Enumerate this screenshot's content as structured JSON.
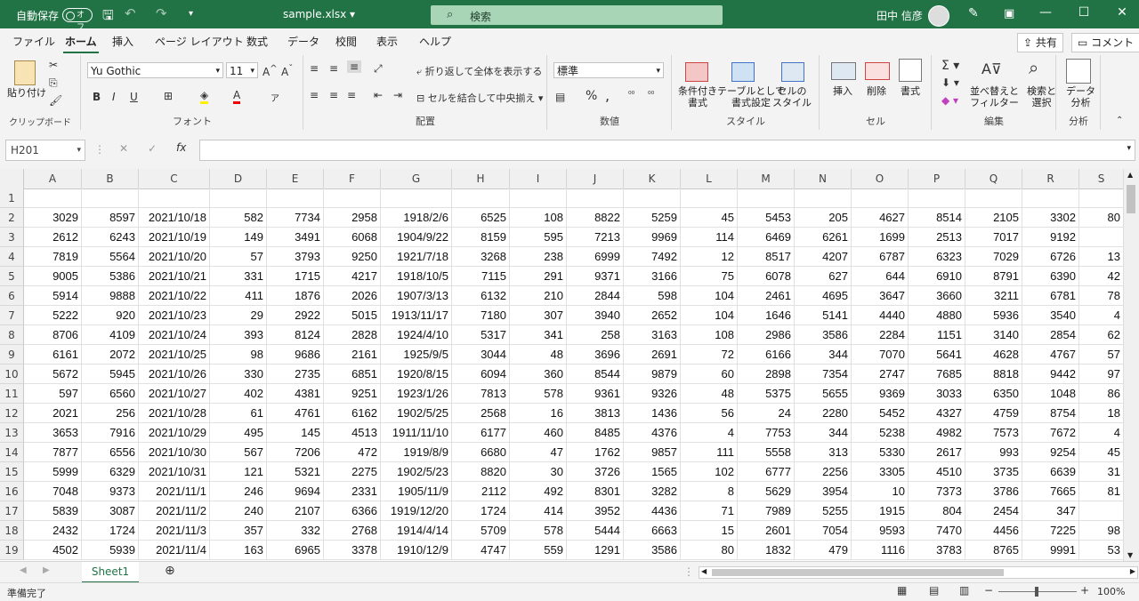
{
  "titlebar": {
    "autosave_label": "自動保存",
    "autosave_state": "オフ",
    "filename": "sample.xlsx ▾",
    "search_placeholder": "検索",
    "user_name": "田中 信彦"
  },
  "tabs": [
    "ファイル",
    "ホーム",
    "挿入",
    "ページ レイアウト",
    "数式",
    "データ",
    "校閲",
    "表示",
    "ヘルプ"
  ],
  "active_tab": "ホーム",
  "actions": {
    "share": "共有",
    "comment": "コメント"
  },
  "ribbon": {
    "clipboard": {
      "paste": "貼り付け",
      "label": "クリップボード"
    },
    "font": {
      "name": "Yu Gothic",
      "size": "11",
      "label": "フォント"
    },
    "alignment": {
      "wrap": "折り返して全体を表示する",
      "merge": "セルを結合して中央揃え",
      "label": "配置"
    },
    "number": {
      "format": "標準",
      "label": "数値"
    },
    "styles": {
      "conditional": "条件付き\n書式",
      "table": "テーブルとして\n書式設定",
      "cell": "セルの\nスタイル",
      "label": "スタイル"
    },
    "cells": {
      "insert": "挿入",
      "delete": "削除",
      "format": "書式",
      "label": "セル"
    },
    "editing": {
      "sort": "並べ替えと\nフィルター",
      "find": "検索と\n選択",
      "label": "編集"
    },
    "analysis": {
      "data": "データ\n分析",
      "label": "分析"
    }
  },
  "formula_bar": {
    "name_box": "H201",
    "value": ""
  },
  "columns": [
    "A",
    "B",
    "C",
    "D",
    "E",
    "F",
    "G",
    "H",
    "I",
    "J",
    "K",
    "L",
    "M",
    "N",
    "O",
    "P",
    "Q",
    "R",
    "S"
  ],
  "row_numbers": [
    "1",
    "2",
    "3",
    "4",
    "5",
    "6",
    "7",
    "8",
    "9",
    "10",
    "11",
    "12",
    "13",
    "14",
    "15",
    "16",
    "17",
    "18",
    "19"
  ],
  "rows": [
    [
      "",
      "",
      "",
      "",
      "",
      "",
      "",
      "",
      "",
      "",
      "",
      "",
      "",
      "",
      "",
      "",
      "",
      "",
      ""
    ],
    [
      "3029",
      "8597",
      "2021/10/18",
      "582",
      "7734",
      "2958",
      "1918/2/6",
      "6525",
      "108",
      "8822",
      "5259",
      "45",
      "5453",
      "205",
      "4627",
      "8514",
      "2105",
      "3302",
      "80"
    ],
    [
      "2612",
      "6243",
      "2021/10/19",
      "149",
      "3491",
      "6068",
      "1904/9/22",
      "8159",
      "595",
      "7213",
      "9969",
      "114",
      "6469",
      "6261",
      "1699",
      "2513",
      "7017",
      "9192",
      ""
    ],
    [
      "7819",
      "5564",
      "2021/10/20",
      "57",
      "3793",
      "9250",
      "1921/7/18",
      "3268",
      "238",
      "6999",
      "7492",
      "12",
      "8517",
      "4207",
      "6787",
      "6323",
      "7029",
      "6726",
      "13"
    ],
    [
      "9005",
      "5386",
      "2021/10/21",
      "331",
      "1715",
      "4217",
      "1918/10/5",
      "7115",
      "291",
      "9371",
      "3166",
      "75",
      "6078",
      "627",
      "644",
      "6910",
      "8791",
      "6390",
      "42"
    ],
    [
      "5914",
      "9888",
      "2021/10/22",
      "411",
      "1876",
      "2026",
      "1907/3/13",
      "6132",
      "210",
      "2844",
      "598",
      "104",
      "2461",
      "4695",
      "3647",
      "3660",
      "3211",
      "6781",
      "78"
    ],
    [
      "5222",
      "920",
      "2021/10/23",
      "29",
      "2922",
      "5015",
      "1913/11/17",
      "7180",
      "307",
      "3940",
      "2652",
      "104",
      "1646",
      "5141",
      "4440",
      "4880",
      "5936",
      "3540",
      "4"
    ],
    [
      "8706",
      "4109",
      "2021/10/24",
      "393",
      "8124",
      "2828",
      "1924/4/10",
      "5317",
      "341",
      "258",
      "3163",
      "108",
      "2986",
      "3586",
      "2284",
      "1151",
      "3140",
      "2854",
      "62"
    ],
    [
      "6161",
      "2072",
      "2021/10/25",
      "98",
      "9686",
      "2161",
      "1925/9/5",
      "3044",
      "48",
      "3696",
      "2691",
      "72",
      "6166",
      "344",
      "7070",
      "5641",
      "4628",
      "4767",
      "57"
    ],
    [
      "5672",
      "5945",
      "2021/10/26",
      "330",
      "2735",
      "6851",
      "1920/8/15",
      "6094",
      "360",
      "8544",
      "9879",
      "60",
      "2898",
      "7354",
      "2747",
      "7685",
      "8818",
      "9442",
      "97"
    ],
    [
      "597",
      "6560",
      "2021/10/27",
      "402",
      "4381",
      "9251",
      "1923/1/26",
      "7813",
      "578",
      "9361",
      "9326",
      "48",
      "5375",
      "5655",
      "9369",
      "3033",
      "6350",
      "1048",
      "86"
    ],
    [
      "2021",
      "256",
      "2021/10/28",
      "61",
      "4761",
      "6162",
      "1902/5/25",
      "2568",
      "16",
      "3813",
      "1436",
      "56",
      "24",
      "2280",
      "5452",
      "4327",
      "4759",
      "8754",
      "18"
    ],
    [
      "3653",
      "7916",
      "2021/10/29",
      "495",
      "145",
      "4513",
      "1911/11/10",
      "6177",
      "460",
      "8485",
      "4376",
      "4",
      "7753",
      "344",
      "5238",
      "4982",
      "7573",
      "7672",
      "4"
    ],
    [
      "7877",
      "6556",
      "2021/10/30",
      "567",
      "7206",
      "472",
      "1919/8/9",
      "6680",
      "47",
      "1762",
      "9857",
      "111",
      "5558",
      "313",
      "5330",
      "2617",
      "993",
      "9254",
      "45"
    ],
    [
      "5999",
      "6329",
      "2021/10/31",
      "121",
      "5321",
      "2275",
      "1902/5/23",
      "8820",
      "30",
      "3726",
      "1565",
      "102",
      "6777",
      "2256",
      "3305",
      "4510",
      "3735",
      "6639",
      "31"
    ],
    [
      "7048",
      "9373",
      "2021/11/1",
      "246",
      "9694",
      "2331",
      "1905/11/9",
      "2112",
      "492",
      "8301",
      "3282",
      "8",
      "5629",
      "3954",
      "10",
      "7373",
      "3786",
      "7665",
      "81"
    ],
    [
      "5839",
      "3087",
      "2021/11/2",
      "240",
      "2107",
      "6366",
      "1919/12/20",
      "1724",
      "414",
      "3952",
      "4436",
      "71",
      "7989",
      "5255",
      "1915",
      "804",
      "2454",
      "347",
      ""
    ],
    [
      "2432",
      "1724",
      "2021/11/3",
      "357",
      "332",
      "2768",
      "1914/4/14",
      "5709",
      "578",
      "5444",
      "6663",
      "15",
      "2601",
      "7054",
      "9593",
      "7470",
      "4456",
      "7225",
      "98"
    ],
    [
      "4502",
      "5939",
      "2021/11/4",
      "163",
      "6965",
      "3378",
      "1910/12/9",
      "4747",
      "559",
      "1291",
      "3586",
      "80",
      "1832",
      "479",
      "1116",
      "3783",
      "8765",
      "9991",
      "53"
    ]
  ],
  "sheet_tab": "Sheet1",
  "status": {
    "ready": "準備完了",
    "zoom": "100%"
  }
}
